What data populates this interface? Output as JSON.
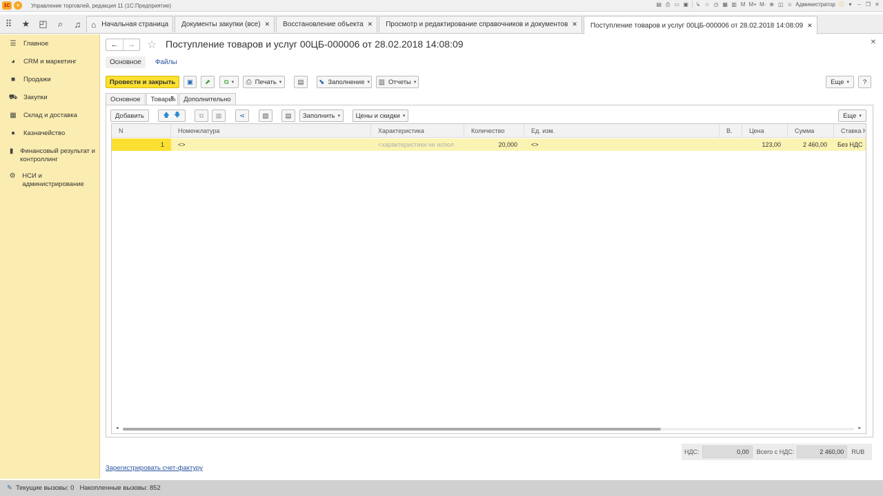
{
  "window": {
    "title": "Управление торговлей, редакция 11  (1С:Предприятие)",
    "user": "Администратор",
    "memory_buttons": [
      "M",
      "M+",
      "M-"
    ]
  },
  "tabs": [
    {
      "label": "Начальная страница",
      "closable": false,
      "active": false
    },
    {
      "label": "Документы закупки (все)",
      "closable": true,
      "active": false
    },
    {
      "label": "Восстановление объекта",
      "closable": true,
      "active": false
    },
    {
      "label": "Просмотр и редактирование справочников и документов",
      "closable": true,
      "active": false
    },
    {
      "label": "Поступление товаров и услуг 00ЦБ-000006 от 28.02.2018 14:08:09",
      "closable": true,
      "active": true
    }
  ],
  "sidebar": {
    "items": [
      {
        "label": "Главное",
        "icon": "list-icon"
      },
      {
        "label": "CRM и маркетинг",
        "icon": "pie-chart-icon"
      },
      {
        "label": "Продажи",
        "icon": "bag-icon"
      },
      {
        "label": "Закупки",
        "icon": "cart-icon"
      },
      {
        "label": "Склад и доставка",
        "icon": "warehouse-icon"
      },
      {
        "label": "Казначейство",
        "icon": "coin-icon"
      },
      {
        "label": "Финансовый результат и контроллинг",
        "icon": "bar-chart-icon"
      },
      {
        "label": "НСИ и администрирование",
        "icon": "gear-icon"
      }
    ]
  },
  "document": {
    "title": "Поступление товаров и услуг 00ЦБ-000006 от 28.02.2018 14:08:09",
    "subtabs": {
      "main": "Основное",
      "files": "Файлы"
    }
  },
  "toolbar": {
    "post_close": "Провести и закрыть",
    "print": "Печать",
    "fill": "Заполнение",
    "reports": "Отчеты",
    "more": "Еще",
    "help": "?"
  },
  "form_tabs": [
    "Основное",
    "Товары",
    "Дополнительно"
  ],
  "items_toolbar": {
    "add": "Добавить",
    "fill": "Заполнить",
    "prices": "Цены и скидки",
    "more": "Еще"
  },
  "grid": {
    "columns": [
      "N",
      "Номенклатура",
      "Характеристика",
      "Количество",
      "Ед. изм.",
      "В.",
      "Цена",
      "Сумма",
      "Ставка Н"
    ],
    "rows": [
      {
        "n": "1",
        "item": "<>",
        "characteristic": "<характеристики не испол",
        "quantity": "20,000",
        "unit": "<>",
        "v": "",
        "price": "123,00",
        "sum": "2 460,00",
        "vat_rate": "Без НДС"
      }
    ]
  },
  "totals": {
    "vat_label": "НДС:",
    "vat_value": "0,00",
    "total_label": "Всего с НДС:",
    "total_value": "2 460,00",
    "currency": "RUB"
  },
  "register_link": "Зарегистрировать счет-фактуру",
  "status": {
    "current_calls": "Текущие вызовы:  0",
    "accumulated_calls": "Накопленные вызовы:  852"
  }
}
